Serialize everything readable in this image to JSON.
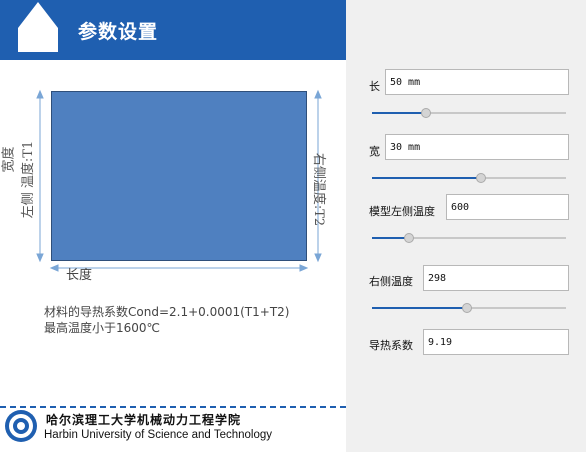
{
  "header": {
    "title": "参数设置"
  },
  "diagram": {
    "width_label": "宽度",
    "left_temp_label": "左侧 温度:T1",
    "right_temp_label": "右侧温度:T2",
    "length_label": "长度",
    "formula_line1": "材料的导热系数Cond=2.1+0.0001(T1+T2)",
    "formula_line2": "最高温度小于1600℃"
  },
  "footer": {
    "university_cn": "哈尔滨理工大学机械动力工程学院",
    "university_en": "Harbin University of Science and Technology"
  },
  "params": {
    "length": {
      "label": "长",
      "value": "50 mm",
      "slider_fraction": 0.28
    },
    "width": {
      "label": "宽",
      "value": "30 mm",
      "slider_fraction": 0.56
    },
    "left_temp": {
      "label": "模型左侧温度",
      "value": "600",
      "slider_fraction": 0.19
    },
    "right_temp": {
      "label": "右侧温度",
      "value": "298",
      "slider_fraction": 0.49
    },
    "conductivity": {
      "label": "导热系数",
      "value": "9.19"
    }
  },
  "colors": {
    "header": "#1f5fb0",
    "rect_fill": "#4f80c0",
    "slider_fill": "#1f5fb0"
  }
}
